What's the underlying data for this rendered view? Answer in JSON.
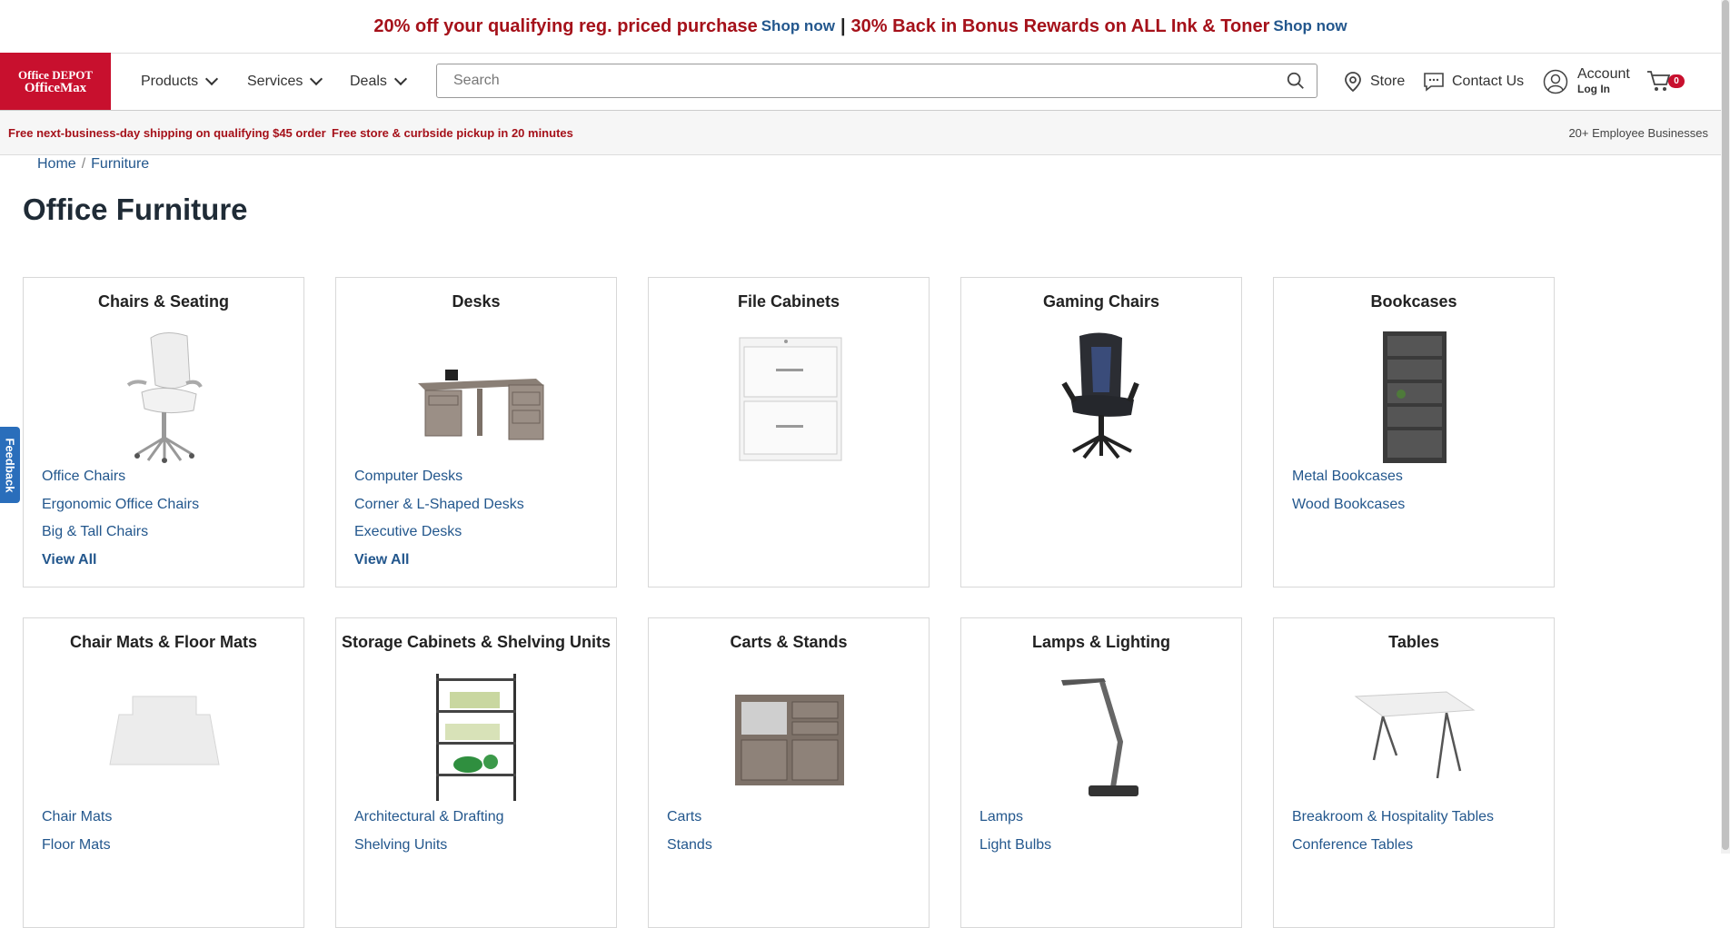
{
  "promo": {
    "text1": "20% off your qualifying reg. priced purchase",
    "link1": "Shop now",
    "separator": "|",
    "text2": "30% Back in Bonus Rewards on ALL Ink & Toner",
    "link2": "Shop now"
  },
  "logo": {
    "line1": "Office DEPOT",
    "line2": "OfficeMax"
  },
  "nav": {
    "products": "Products",
    "services": "Services",
    "deals": "Deals"
  },
  "search": {
    "placeholder": "Search"
  },
  "header": {
    "store": "Store",
    "contact": "Contact Us",
    "account": "Account",
    "login": "Log In",
    "cart_count": "0"
  },
  "shipping": {
    "msg1": "Free next-business-day shipping on qualifying $45 order",
    "msg2": "Free store & curbside pickup in 20 minutes",
    "employee": "20+ Employee Businesses"
  },
  "breadcrumb": {
    "home": "Home",
    "sep": "/",
    "current": "Furniture"
  },
  "page_title": "Office Furniture",
  "feedback": "Feedback",
  "colors": {
    "brand_red": "#c8102e",
    "promo_red": "#a5111a",
    "link_blue": "#23578d",
    "feedback_blue": "#2a6ebb"
  },
  "categories": [
    {
      "title": "Chairs & Seating",
      "image": "office-chair-image",
      "links": [
        "Office Chairs",
        "Ergonomic Office Chairs",
        "Big & Tall Chairs"
      ],
      "view_all": "View All"
    },
    {
      "title": "Desks",
      "image": "l-desk-image",
      "links": [
        "Computer Desks",
        "Corner & L-Shaped Desks",
        "Executive Desks"
      ],
      "view_all": "View All"
    },
    {
      "title": "File Cabinets",
      "image": "file-cabinet-image",
      "links": []
    },
    {
      "title": "Gaming Chairs",
      "image": "gaming-chair-image",
      "links": []
    },
    {
      "title": "Bookcases",
      "image": "bookcase-image",
      "links": [
        "Metal Bookcases",
        "Wood Bookcases"
      ]
    },
    {
      "title": "Chair Mats & Floor Mats",
      "image": "chair-mat-image",
      "links": [
        "Chair Mats",
        "Floor Mats"
      ]
    },
    {
      "title": "Storage Cabinets & Shelving Units",
      "image": "shelving-unit-image",
      "links": [
        "Architectural & Drafting",
        "Shelving Units"
      ]
    },
    {
      "title": "Carts & Stands",
      "image": "cart-stand-image",
      "links": [
        "Carts",
        "Stands"
      ]
    },
    {
      "title": "Lamps & Lighting",
      "image": "desk-lamp-image",
      "links": [
        "Lamps",
        "Light Bulbs"
      ]
    },
    {
      "title": "Tables",
      "image": "folding-table-image",
      "links": [
        "Breakroom & Hospitality Tables",
        "Conference Tables"
      ]
    }
  ]
}
